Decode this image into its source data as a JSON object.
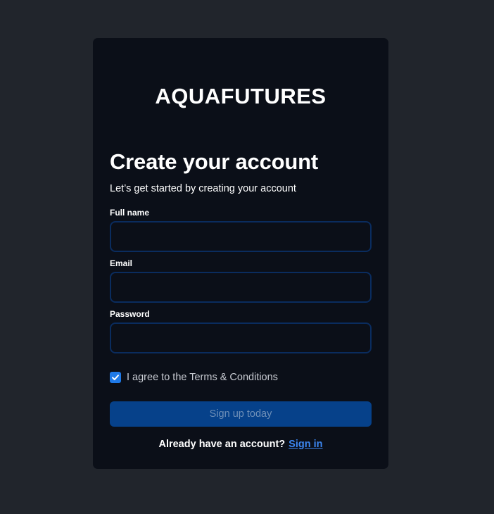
{
  "brand": {
    "logo_text": "AQUAFUTURES"
  },
  "form": {
    "title": "Create your account",
    "subtitle": "Let’s get started by creating your account",
    "fields": [
      {
        "label": "Full name",
        "value": "",
        "placeholder": ""
      },
      {
        "label": "Email",
        "value": "",
        "placeholder": ""
      },
      {
        "label": "Password",
        "value": "",
        "placeholder": ""
      }
    ],
    "terms": {
      "label": "I agree to the Terms & Conditions",
      "checked": true
    },
    "submit_label": "Sign up today"
  },
  "footer": {
    "prompt": "Already have an account?",
    "link_label": "Sign in"
  },
  "colors": {
    "page_background": "#21252c",
    "card_background": "#0b0f18",
    "field_border": "#0a2c5e",
    "button_background": "#06418a",
    "link": "#3c86f0",
    "checkbox": "#1f7ae8"
  }
}
